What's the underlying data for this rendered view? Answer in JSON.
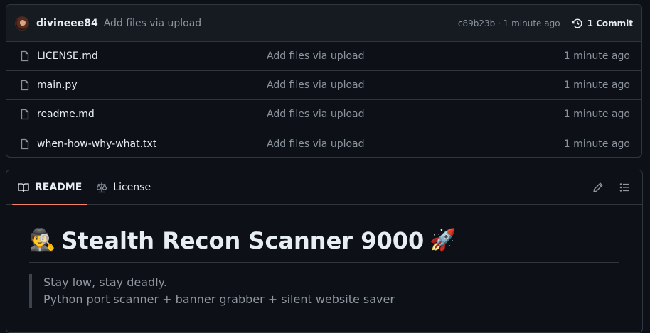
{
  "commit": {
    "author": "divineee84",
    "message": "Add files via upload",
    "meta": "c89b23b · 1 minute ago",
    "count_label": "1 Commit"
  },
  "files": [
    {
      "name": "LICENSE.md",
      "message": "Add files via upload",
      "time": "1 minute ago"
    },
    {
      "name": "main.py",
      "message": "Add files via upload",
      "time": "1 minute ago"
    },
    {
      "name": "readme.md",
      "message": "Add files via upload",
      "time": "1 minute ago"
    },
    {
      "name": "when-how-why-what.txt",
      "message": "Add files via upload",
      "time": "1 minute ago"
    }
  ],
  "readme": {
    "tabs": [
      {
        "label": "README",
        "icon": "book-icon",
        "active": true
      },
      {
        "label": "License",
        "icon": "scale-icon",
        "active": false
      }
    ],
    "title_emoji_start": "🕵️",
    "title": "Stealth Recon Scanner 9000",
    "title_emoji_end": "🚀",
    "quote_line_1": "Stay low, stay deadly.",
    "quote_line_2": "Python port scanner + banner grabber + silent website saver"
  },
  "colors": {
    "background": "#0d1117",
    "header_bg": "#161b22",
    "border": "#30363d",
    "muted_text": "#8b949e",
    "tab_underline": "#f78166"
  }
}
